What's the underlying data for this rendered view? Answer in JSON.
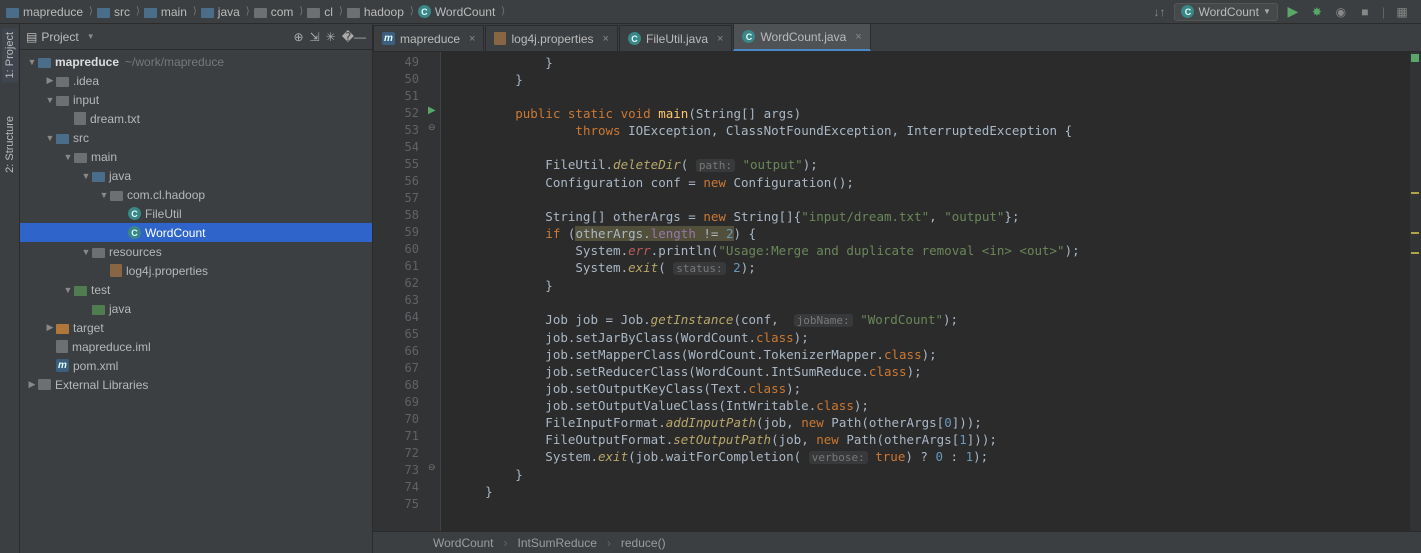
{
  "breadcrumb": [
    "mapreduce",
    "src",
    "main",
    "java",
    "com",
    "cl",
    "hadoop",
    "WordCount"
  ],
  "breadcrumb_icons": [
    "folder-blue",
    "folder-blue",
    "folder-blue",
    "folder-blue",
    "folder-gray",
    "folder-gray",
    "folder-gray",
    "class"
  ],
  "run_config": "WordCount",
  "left_tabs": {
    "project": "1: Project",
    "structure": "2: Structure"
  },
  "panel_title": "Project",
  "tree": [
    {
      "indent": 0,
      "arrow": "down",
      "icon": "folder-blue",
      "text": "mapreduce",
      "bold": true,
      "path": "~/work/mapreduce"
    },
    {
      "indent": 1,
      "arrow": "right",
      "icon": "folder-gray",
      "text": ".idea"
    },
    {
      "indent": 1,
      "arrow": "down",
      "icon": "folder-gray",
      "text": "input"
    },
    {
      "indent": 2,
      "arrow": "none",
      "icon": "file-txt",
      "text": "dream.txt"
    },
    {
      "indent": 1,
      "arrow": "down",
      "icon": "folder-blue",
      "text": "src"
    },
    {
      "indent": 2,
      "arrow": "down",
      "icon": "folder-gray",
      "text": "main"
    },
    {
      "indent": 3,
      "arrow": "down",
      "icon": "folder-blue",
      "text": "java"
    },
    {
      "indent": 4,
      "arrow": "down",
      "icon": "folder-gray",
      "text": "com.cl.hadoop"
    },
    {
      "indent": 5,
      "arrow": "none",
      "icon": "class",
      "text": "FileUtil"
    },
    {
      "indent": 5,
      "arrow": "none",
      "icon": "class",
      "text": "WordCount",
      "sel": true
    },
    {
      "indent": 3,
      "arrow": "down",
      "icon": "folder-gray",
      "text": "resources"
    },
    {
      "indent": 4,
      "arrow": "none",
      "icon": "file-prop",
      "text": "log4j.properties"
    },
    {
      "indent": 2,
      "arrow": "down",
      "icon": "folder-green",
      "text": "test"
    },
    {
      "indent": 3,
      "arrow": "none",
      "icon": "folder-green",
      "text": "java"
    },
    {
      "indent": 1,
      "arrow": "right",
      "icon": "folder-orange",
      "text": "target"
    },
    {
      "indent": 1,
      "arrow": "none",
      "icon": "file-iml",
      "text": "mapreduce.iml"
    },
    {
      "indent": 1,
      "arrow": "none",
      "icon": "m",
      "text": "pom.xml"
    },
    {
      "indent": 0,
      "arrow": "right",
      "icon": "lib",
      "text": "External Libraries"
    }
  ],
  "tabs": [
    {
      "icon": "m",
      "label": "mapreduce",
      "active": false
    },
    {
      "icon": "file-prop",
      "label": "log4j.properties",
      "active": false
    },
    {
      "icon": "class",
      "label": "FileUtil.java",
      "active": false
    },
    {
      "icon": "class",
      "label": "WordCount.java",
      "active": true
    }
  ],
  "line_start": 49,
  "line_end": 75,
  "run_line": 52,
  "code_lines": [
    "            }",
    "        }",
    "",
    "        <span class='kw'>public static void</span> <span class='mtd-s'>main</span>(String[] args)",
    "                <span class='kw'>throws</span> IOException, ClassNotFoundException, InterruptedException {",
    "",
    "            FileUtil.<span class='mtd-i'>deleteDir</span>( <span class='hint'>path:</span> <span class='str'>\"output\"</span>);",
    "            Configuration conf = <span class='kw'>new</span> Configuration();",
    "",
    "            String[] otherArgs = <span class='kw'>new</span> String[]{<span class='str'>\"input/dream.txt\"</span>, <span class='str'>\"output\"</span>};",
    "            <span class='kw'>if</span> (<span class='warn-bg'>otherArgs.<span class='fld'>length</span> != <span class='num'>2</span></span>) {",
    "                System.<span class='err'>err</span>.println(<span class='str'>\"Usage:Merge and duplicate removal &lt;in&gt; &lt;out&gt;\"</span>);",
    "                System.<span class='mtd-i'>exit</span>( <span class='hint'>status:</span> <span class='num'>2</span>);",
    "            }",
    "",
    "            Job job = Job.<span class='mtd-i'>getInstance</span>(conf,  <span class='hint'>jobName:</span> <span class='str'>\"WordCount\"</span>);",
    "            job.setJarByClass(WordCount.<span class='kw'>class</span>);",
    "            job.setMapperClass(WordCount.TokenizerMapper.<span class='kw'>class</span>);",
    "            job.setReducerClass(WordCount.IntSumReduce.<span class='kw'>class</span>);",
    "            job.setOutputKeyClass(Text.<span class='kw'>class</span>);",
    "            job.setOutputValueClass(IntWritable.<span class='kw'>class</span>);",
    "            FileInputFormat.<span class='mtd-i'>addInputPath</span>(job, <span class='kw'>new</span> Path(otherArgs[<span class='num'>0</span>]));",
    "            FileOutputFormat.<span class='mtd-i'>setOutputPath</span>(job, <span class='kw'>new</span> Path(otherArgs[<span class='num'>1</span>]));",
    "            System.<span class='mtd-i'>exit</span>(job.waitForCompletion( <span class='hint'>verbose:</span> <span class='kw'>true</span>) ? <span class='num'>0</span> : <span class='num'>1</span>);",
    "        }",
    "    }",
    ""
  ],
  "bottom_crumb": [
    "WordCount",
    "IntSumReduce",
    "reduce()"
  ]
}
